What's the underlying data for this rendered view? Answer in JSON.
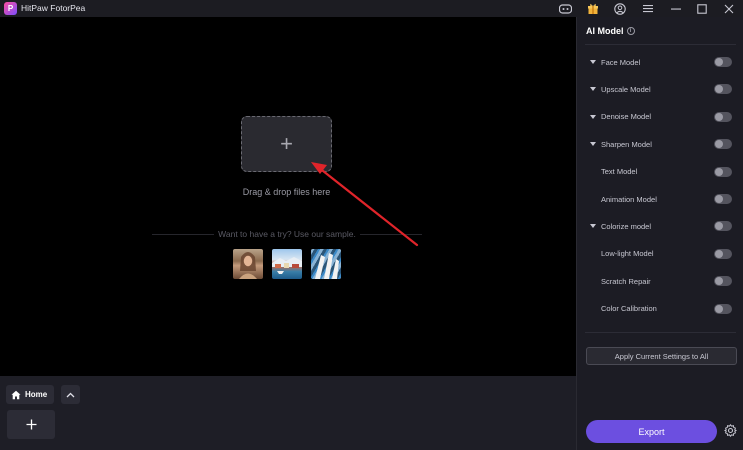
{
  "app": {
    "title": "HitPaw FotorPea",
    "logo_letter": "P"
  },
  "titlebar_icons": {
    "discord": "discord-icon",
    "gift": "gift-icon",
    "account": "account-icon",
    "menu": "menu-icon",
    "minimize": "minimize-icon",
    "maximize": "maximize-icon",
    "close": "close-icon"
  },
  "canvas": {
    "drop_text": "Drag & drop files here",
    "sample_text": "Want to have a try? Use our sample.",
    "samples": [
      "portrait",
      "harbor",
      "zebra"
    ]
  },
  "bottombar": {
    "home_label": "Home"
  },
  "panel": {
    "title": "AI Model",
    "models": [
      {
        "label": "Face Model",
        "expandable": true,
        "enabled": false
      },
      {
        "label": "Upscale Model",
        "expandable": true,
        "enabled": false
      },
      {
        "label": "Denoise Model",
        "expandable": true,
        "enabled": false
      },
      {
        "label": "Sharpen Model",
        "expandable": true,
        "enabled": false
      },
      {
        "label": "Text Model",
        "expandable": false,
        "enabled": false
      },
      {
        "label": "Animation Model",
        "expandable": false,
        "enabled": false
      },
      {
        "label": "Colorize model",
        "expandable": true,
        "enabled": false
      },
      {
        "label": "Low-light Model",
        "expandable": false,
        "enabled": false
      },
      {
        "label": "Scratch Repair",
        "expandable": false,
        "enabled": false
      },
      {
        "label": "Color Calibration",
        "expandable": false,
        "enabled": false
      }
    ],
    "apply_label": "Apply Current Settings to All",
    "export_label": "Export"
  },
  "colors": {
    "accent": "#6c4fe0",
    "annotation_arrow": "#e0242a"
  }
}
